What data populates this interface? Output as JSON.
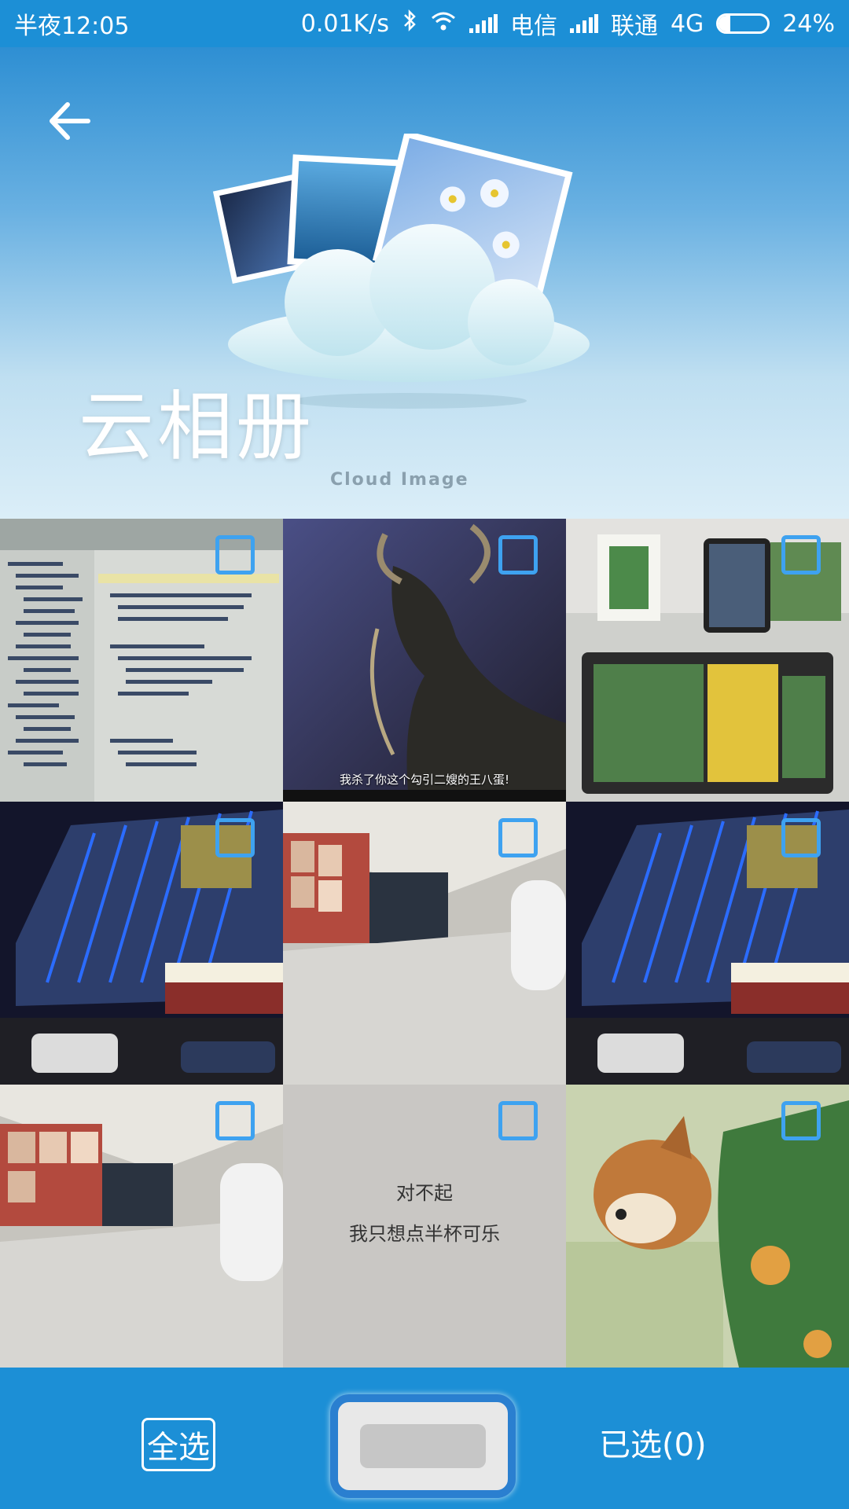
{
  "status_bar": {
    "time": "半夜12:05",
    "speed": "0.01K/s",
    "carrier1": "电信",
    "carrier2": "联通",
    "network": "4G",
    "battery": "24%",
    "battery_level": 0.24
  },
  "header": {
    "title": "云相册",
    "subtitle": "Cloud Image"
  },
  "grid": {
    "tiles": [
      {
        "kind": "code-screen",
        "selected": false
      },
      {
        "kind": "movie-still",
        "caption": "我杀了你这个勾引二嫂的王八蛋!",
        "selected": false
      },
      {
        "kind": "electronics",
        "selected": false
      },
      {
        "kind": "night-mall",
        "selected": false
      },
      {
        "kind": "mall-interior",
        "selected": false
      },
      {
        "kind": "night-mall",
        "selected": false
      },
      {
        "kind": "mall-interior",
        "selected": false
      },
      {
        "kind": "text-card",
        "text_line1": "对不起",
        "text_line2": "我只想点半杯可乐",
        "selected": false
      },
      {
        "kind": "dog",
        "selected": false
      }
    ]
  },
  "bottom_bar": {
    "select_all": "全选",
    "selected_count": "已选(0)"
  },
  "colors": {
    "accent": "#1c8fd6",
    "checkbox": "#3ea2f0"
  }
}
